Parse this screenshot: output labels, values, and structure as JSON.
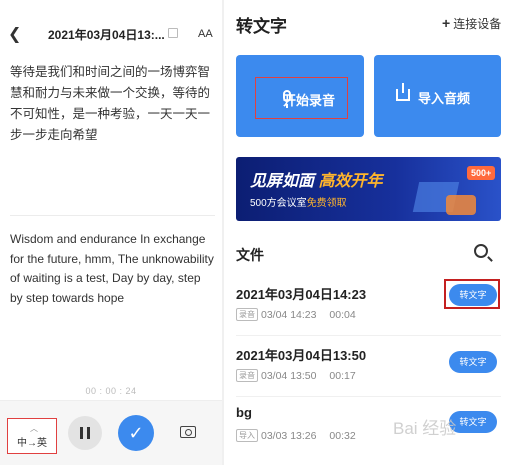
{
  "left_panel": {
    "title": "2021年03月04日13:...",
    "font_size_label": "AA",
    "chinese_text": "等待是我们和时间之间的一场博弈智慧和耐力与未来做一个交换，等待的不可知性，是一种考验，一天一天一步一步走向希望",
    "english_text": "Wisdom and endurance In exchange for the future, hmm, The unknowability of waiting is a test, Day by day, step by step towards hope",
    "timer": "00 : 00 : 24",
    "language_toggle": "中→英"
  },
  "right_panel": {
    "title": "转文字",
    "connect_device": "连接设备",
    "start_recording": "开始录音",
    "import_audio": "导入音频",
    "banner": {
      "line1_a": "见屏如面 ",
      "line1_b": "高效开年",
      "line2_a": "500方会议室",
      "line2_b": "免费领取",
      "badge": "500+"
    },
    "files_heading": "文件",
    "files": [
      {
        "name": "2021年03月04日14:23",
        "tag": "录音",
        "date": "03/04",
        "time": "14:23",
        "duration": "00:04",
        "action": "转文字"
      },
      {
        "name": "2021年03月04日13:50",
        "tag": "录音",
        "date": "03/04",
        "time": "13:50",
        "duration": "00:17",
        "action": "转文字"
      },
      {
        "name": "bg",
        "tag": "导入",
        "date": "03/03",
        "time": "13:26",
        "duration": "00:32",
        "action": "转文字"
      }
    ]
  },
  "watermark": "Bai 经验",
  "colors": {
    "accent": "#3c8aee",
    "highlight_box": "#d02828",
    "banner_bg": "#14288c",
    "banner_highlight": "#ffb52c"
  }
}
